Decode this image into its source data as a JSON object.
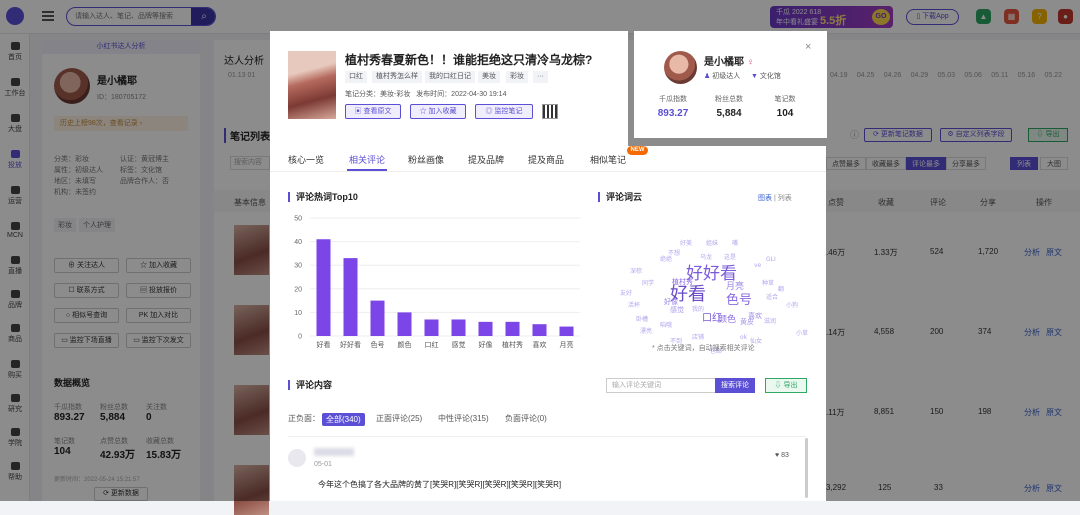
{
  "topbar": {
    "search_placeholder": "请输入达人、笔记、品牌等搜索",
    "banner_line1": "千瓜 2022 618",
    "banner_line2": "年中看礼盛宴",
    "banner_big": "5.5折",
    "banner_go": "GO",
    "download_app": "下载App"
  },
  "sidebar": {
    "items": [
      {
        "label": "首页"
      },
      {
        "label": "工作台"
      },
      {
        "label": "大盘"
      },
      {
        "label": "投放"
      },
      {
        "label": "运营"
      },
      {
        "label": "MCN"
      },
      {
        "label": "直播"
      },
      {
        "label": "品牌"
      },
      {
        "label": "商品"
      },
      {
        "label": "购买"
      },
      {
        "label": "研究"
      },
      {
        "label": "学院"
      },
      {
        "label": "帮助"
      }
    ]
  },
  "profile": {
    "header": "小红书达人分析",
    "name": "是小橘耶",
    "id": "ID：180705172",
    "history": "历史上榜98次，查看记录",
    "info": [
      "分类：彩妆",
      "认证：黄冠博主",
      "属性：初级达人",
      "标签：文化馆",
      "地区：未填写",
      "品牌合作人：否",
      "机构：未签约"
    ],
    "tags": [
      "彩妆",
      "个人护理"
    ],
    "buttons": [
      "关注达人",
      "加入收藏",
      "联系方式",
      "投放报价",
      "相似号查询",
      "加入对比",
      "监控下场直播",
      "监控下次发文"
    ],
    "section": "数据概览",
    "stats": [
      {
        "label": "千瓜指数",
        "value": "893.27"
      },
      {
        "label": "粉丝总数",
        "value": "5,884"
      },
      {
        "label": "关注数",
        "value": "0"
      },
      {
        "label": "笔记数",
        "value": "104"
      },
      {
        "label": "点赞总数",
        "value": "42.93万"
      },
      {
        "label": "收藏总数",
        "value": "15.83万"
      }
    ],
    "updated": "更新时间：2022-05-24 15:21:57",
    "update_btn": "更新数据"
  },
  "main": {
    "title": "达人分析",
    "notes_title": "笔记列表",
    "search_placeholder": "搜索内容",
    "col_basic": "基本信息",
    "columns": [
      "点赞",
      "收藏",
      "评论",
      "分享",
      "操作"
    ],
    "sorts": [
      "点赞最多",
      "收藏最多",
      "评论最多",
      "分享最多"
    ],
    "view_list": "列表",
    "view_big": "大图",
    "btn_update": "更新笔记数据",
    "btn_custom": "自定义列表字段",
    "btn_export": "导出",
    "dates": [
      "04.19",
      "04.25",
      "04.26",
      "04.29",
      "05.03",
      "05.06",
      "05.11",
      "05.16",
      "05.22"
    ],
    "left_dates": [
      "01.13",
      "01"
    ],
    "rows": [
      {
        "likes": ".46万",
        "collect": "1.33万",
        "comments": "524",
        "shares": "1,720"
      },
      {
        "likes": ".14万",
        "collect": "4,558",
        "comments": "200",
        "shares": "374"
      },
      {
        "likes": ".11万",
        "collect": "8,851",
        "comments": "150",
        "shares": "198"
      },
      {
        "likes": "3,292",
        "collect": "125",
        "comments": "33",
        "shares": ""
      }
    ],
    "op_analyze": "分析",
    "op_original": "原文"
  },
  "note": {
    "title": "植村秀春夏新色！！谁能拒绝这只清冷乌龙棕?",
    "chips": [
      "口红",
      "植村秀怎么样",
      "我的口红日记",
      "美妆",
      "彩妆",
      "···"
    ],
    "category": "笔记分类：美妆-彩妆",
    "published": "发布时间：2022-04-30 19:14",
    "btn_view": "查看原文",
    "btn_fav": "加入收藏",
    "btn_monitor": "监控笔记"
  },
  "author": {
    "name": "是小橘耶",
    "level": "初级达人",
    "tag": "文化馆",
    "close": "×",
    "stats": [
      {
        "label": "千瓜指数",
        "value": "893.27",
        "color": "#5b4fd6"
      },
      {
        "label": "粉丝总数",
        "value": "5,884",
        "color": "#222222"
      },
      {
        "label": "笔记数",
        "value": "104",
        "color": "#222222"
      }
    ]
  },
  "tabs": [
    "核心一览",
    "相关评论",
    "粉丝画像",
    "提及品牌",
    "提及商品",
    "相似笔记"
  ],
  "new_badge": "NEW",
  "bar_section_title": "评论热词Top10",
  "cloud_section_title": "评论词云",
  "cloud_view_chart": "图表",
  "cloud_view_sep": "|",
  "cloud_view_list": "列表",
  "cloud_hint": "* 点击关键词，自动搜索相关评论",
  "chart_data": {
    "type": "bar",
    "categories": [
      "好看",
      "好好看",
      "色号",
      "颜色",
      "口红",
      "感觉",
      "好像",
      "植村秀",
      "喜欢",
      "月亮"
    ],
    "values": [
      41,
      33,
      15,
      10,
      7,
      7,
      6,
      6,
      5,
      4
    ],
    "ylim": [
      0,
      50
    ],
    "yticks": [
      0,
      10,
      20,
      30,
      40,
      50
    ],
    "color": "#7b45e8"
  },
  "cloud": [
    {
      "t": "好好看",
      "s": 17,
      "c": "#7a5bd9"
    },
    {
      "t": "好看",
      "s": 18,
      "c": "#6a4bc8"
    },
    {
      "t": "色号",
      "s": 13,
      "c": "#8a6ae0"
    },
    {
      "t": "月亮",
      "s": 9,
      "c": "#9a86e6"
    },
    {
      "t": "口红",
      "s": 10,
      "c": "#7a5bd9"
    },
    {
      "t": "颜色",
      "s": 9,
      "c": "#8a6ae0"
    },
    {
      "t": "喜欢",
      "s": 7,
      "c": "#9a86e6"
    },
    {
      "t": "植村秀",
      "s": 7,
      "c": "#8a6ae0"
    },
    {
      "t": "好像",
      "s": 7,
      "c": "#9a86e6"
    },
    {
      "t": "感觉",
      "s": 7,
      "c": "#a898ea"
    },
    {
      "t": "黄皮",
      "s": 7,
      "c": "#a898ea"
    },
    {
      "t": "好美",
      "s": 6,
      "c": "#b3a6ee"
    },
    {
      "t": "姐妹",
      "s": 6,
      "c": "#b3a6ee"
    },
    {
      "t": "嘴",
      "s": 6,
      "c": "#b3a6ee"
    },
    {
      "t": "绝绝",
      "s": 6,
      "c": "#b3a6ee"
    },
    {
      "t": "不想",
      "s": 6,
      "c": "#b3a6ee"
    },
    {
      "t": "乌龙",
      "s": 6,
      "c": "#b3a6ee"
    },
    {
      "t": "这是",
      "s": 6,
      "c": "#b3a6ee"
    },
    {
      "t": "深棕",
      "s": 6,
      "c": "#b3a6ee"
    },
    {
      "t": "同学",
      "s": 6,
      "c": "#b3a6ee"
    },
    {
      "t": "适合",
      "s": 6,
      "c": "#b3a6ee"
    },
    {
      "t": "种草",
      "s": 6,
      "c": "#b3a6ee"
    },
    {
      "t": "友好",
      "s": 6,
      "c": "#b3a6ee"
    },
    {
      "t": "小狗",
      "s": 6,
      "c": "#b3a6ee"
    },
    {
      "t": "活杯",
      "s": 6,
      "c": "#b3a6ee"
    },
    {
      "t": "卧槽",
      "s": 6,
      "c": "#b3a6ee"
    },
    {
      "t": "小草",
      "s": 6,
      "c": "#b3a6ee"
    },
    {
      "t": "漂亮",
      "s": 6,
      "c": "#b3a6ee"
    },
    {
      "t": "不到",
      "s": 6,
      "c": "#b3a6ee"
    },
    {
      "t": "店铺",
      "s": 6,
      "c": "#b3a6ee"
    },
    {
      "t": "包邮",
      "s": 6,
      "c": "#b3a6ee"
    },
    {
      "t": "仙女",
      "s": 6,
      "c": "#b3a6ee"
    },
    {
      "t": "GLI",
      "s": 6,
      "c": "#b3a6ee"
    },
    {
      "t": "ok",
      "s": 6,
      "c": "#b3a6ee"
    },
    {
      "t": "滋润",
      "s": 6,
      "c": "#b3a6ee"
    },
    {
      "t": "我的",
      "s": 6,
      "c": "#b3a6ee"
    },
    {
      "t": "咱哦",
      "s": 6,
      "c": "#b3a6ee"
    },
    {
      "t": "ve",
      "s": 6,
      "c": "#b3a6ee"
    },
    {
      "t": "翻",
      "s": 6,
      "c": "#b3a6ee"
    }
  ],
  "comments": {
    "title": "评论内容",
    "search_placeholder": "输入评论关键词",
    "search_btn": "搜索评论",
    "export": "导出",
    "filter_label": "正负面：",
    "filters": [
      "全部(340)",
      "正面评论(25)",
      "中性评论(315)",
      "负面评论(0)"
    ],
    "date": "05-01",
    "likes": "83",
    "text": "今年这个色搞了各大品牌的黄了[笑哭R][笑哭R][笑哭R][笑哭R][笑哭R]"
  }
}
